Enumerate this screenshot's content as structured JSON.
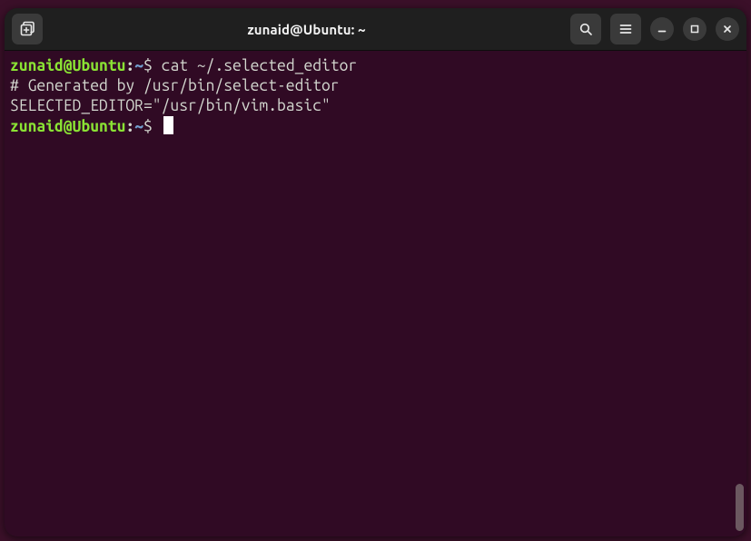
{
  "window": {
    "title": "zunaid@Ubuntu: ~"
  },
  "prompt1": {
    "user_host": "zunaid@Ubuntu",
    "colon": ":",
    "path": "~",
    "dollar": "$ ",
    "command": "cat ~/.selected_editor"
  },
  "output": {
    "line1": "# Generated by /usr/bin/select-editor",
    "line2": "SELECTED_EDITOR=\"/usr/bin/vim.basic\""
  },
  "prompt2": {
    "user_host": "zunaid@Ubuntu",
    "colon": ":",
    "path": "~",
    "dollar": "$ "
  },
  "icons": {
    "new_tab": "new-tab-icon",
    "search": "search-icon",
    "menu": "hamburger-icon",
    "minimize": "minimize-icon",
    "maximize": "maximize-icon",
    "close": "close-icon"
  }
}
